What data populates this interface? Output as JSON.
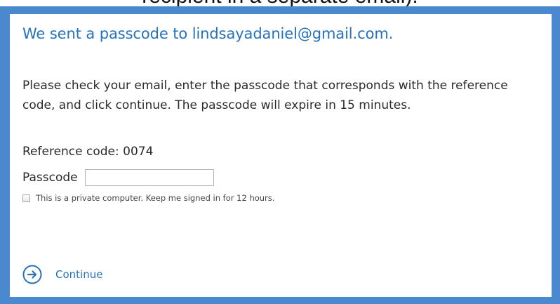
{
  "top_caption": "recipient in a separate email).",
  "heading": "We sent a passcode to lindsayadaniel@gmail.com.",
  "instructions": "Please check your email, enter the passcode that corresponds with the reference code, and click continue. The passcode will expire in 15 minutes.",
  "reference_code": "Reference code: 0074",
  "passcode": {
    "label": "Passcode",
    "value": ""
  },
  "keep_signed_in": {
    "label": "This is a private computer. Keep me signed in for 12 hours.",
    "checked": false
  },
  "continue": {
    "label": "Continue",
    "icon": "arrow-right-circle-icon"
  },
  "colors": {
    "frame": "#4a88cf",
    "accent": "#2672b8"
  }
}
